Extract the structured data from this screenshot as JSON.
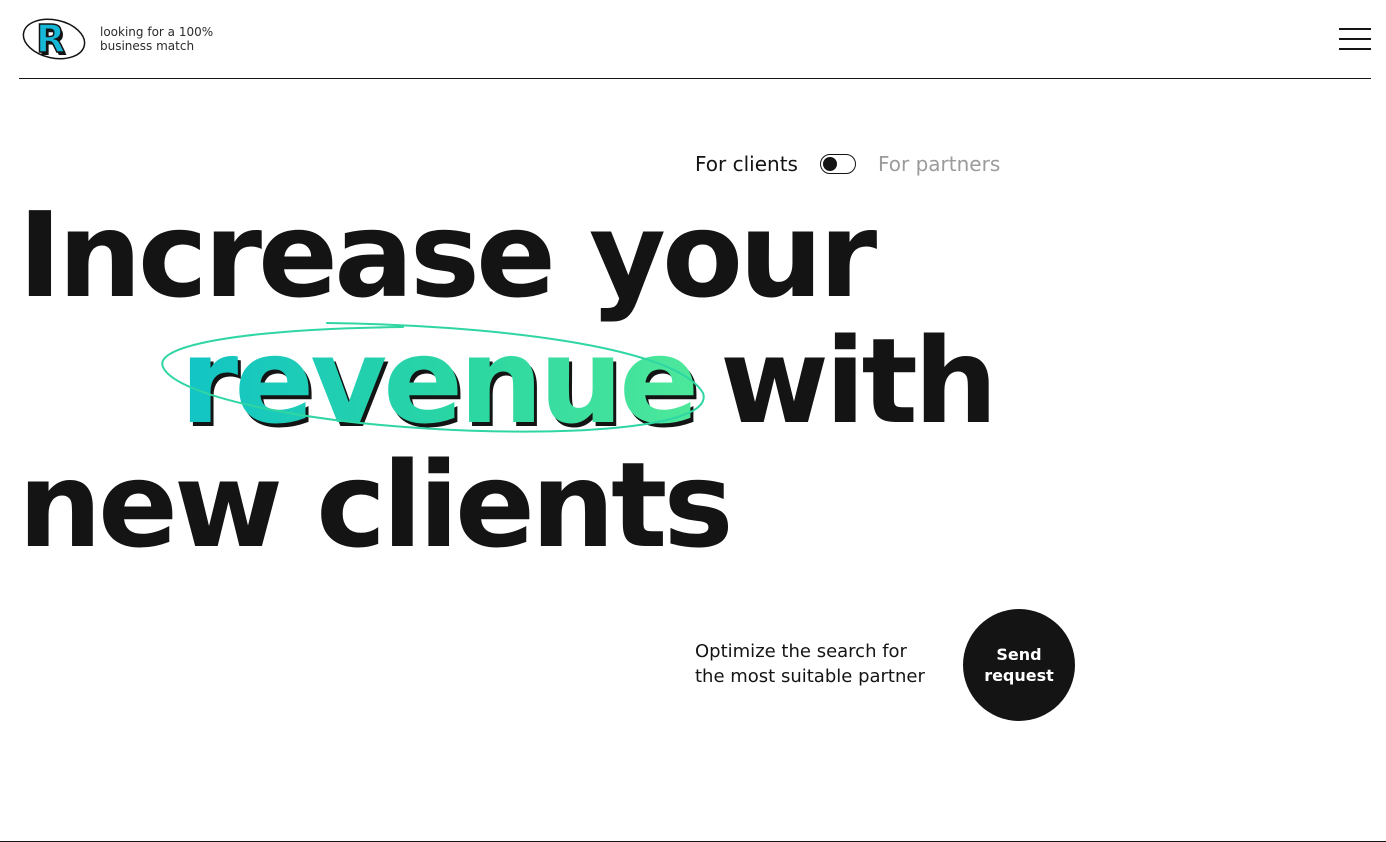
{
  "header": {
    "logo_letter": "R",
    "tagline_lines": [
      "looking for a 100%",
      "business match"
    ],
    "menu_icon": "hamburger-icon"
  },
  "audience_toggle": {
    "left_label": "For clients",
    "right_label": "For partners",
    "selected": "For clients"
  },
  "hero": {
    "line1": "Increase your",
    "highlight": "revenue",
    "line2_rest": "with",
    "line3": "new clients"
  },
  "cta": {
    "subtitle_lines": [
      "Optimize the search for",
      "the most suitable partner"
    ],
    "button_lines": [
      "Send",
      "request"
    ]
  },
  "colors": {
    "text": "#141414",
    "muted": "#9b9b9b",
    "accent_start": "#12c4c6",
    "accent_end": "#4de89a",
    "background": "#ffffff"
  }
}
